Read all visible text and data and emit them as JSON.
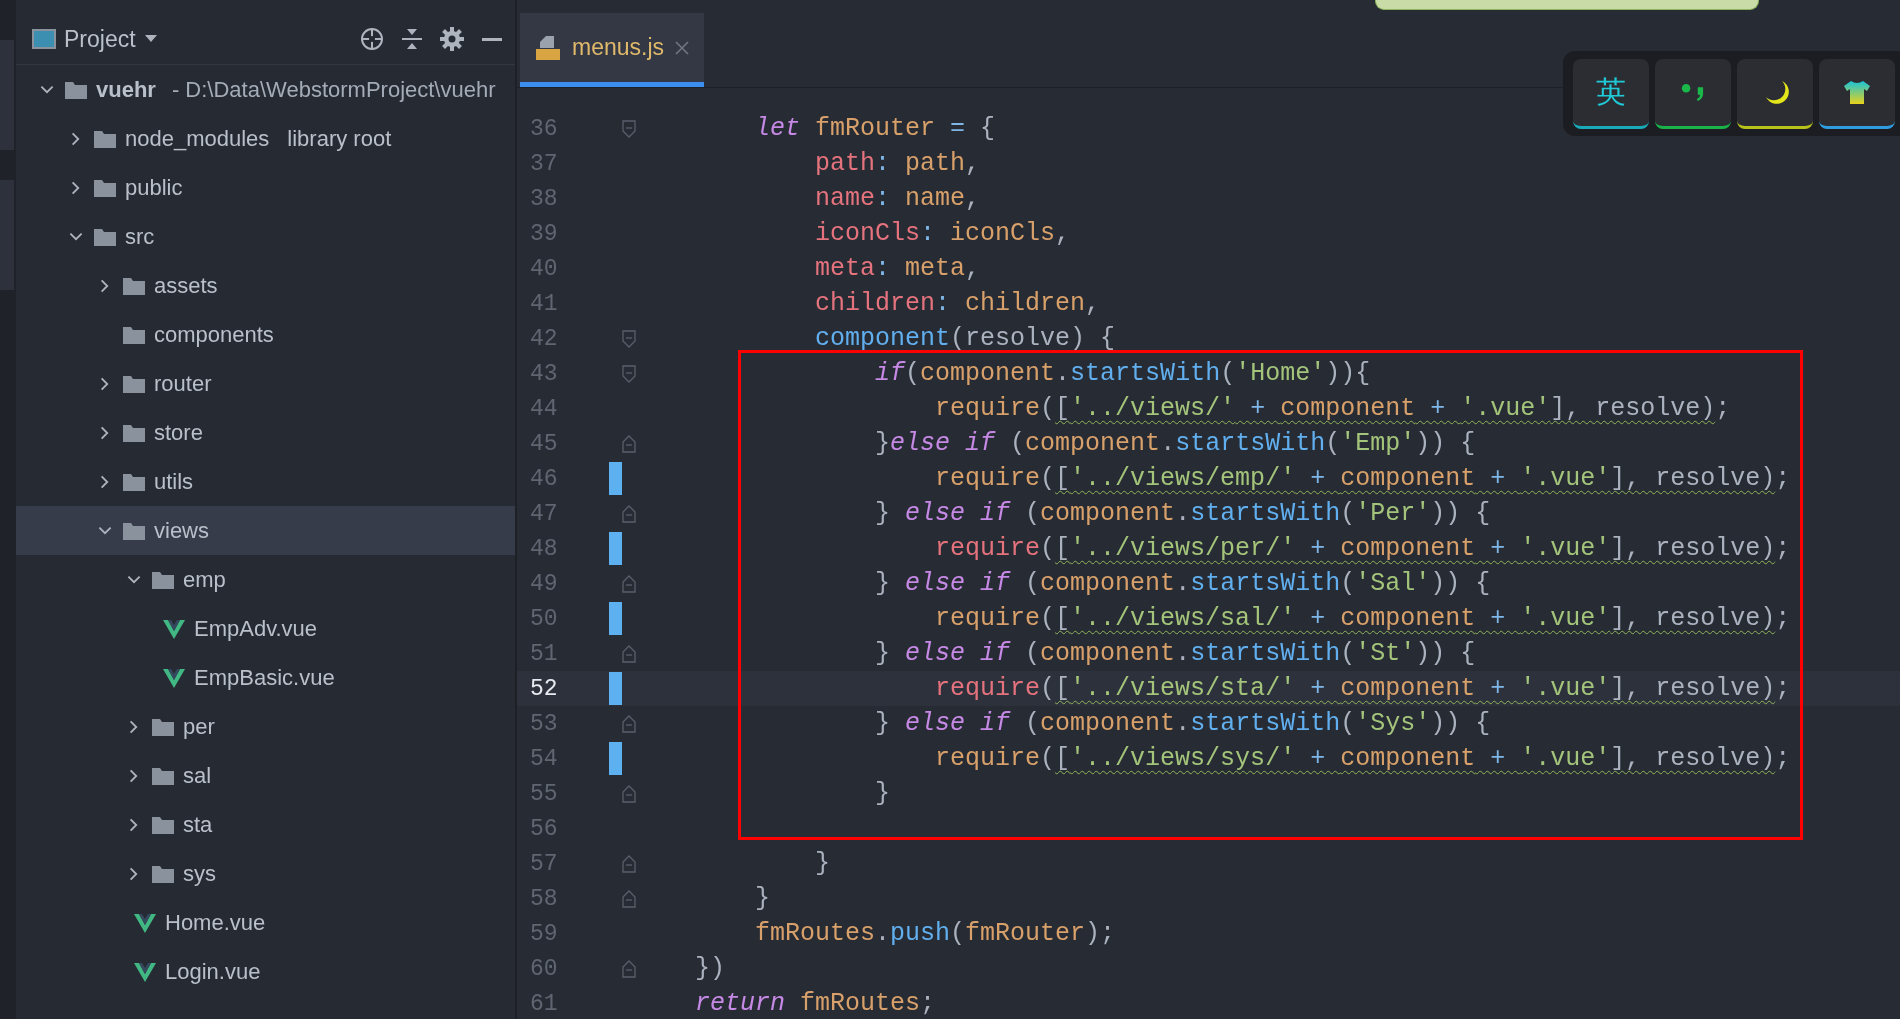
{
  "project_panel": {
    "title": "Project",
    "tree": [
      {
        "kind": "root",
        "label": "vuehr",
        "path": "- D:\\Data\\WebstormProject\\vuehr",
        "expanded": true,
        "selected": false,
        "children": [
          {
            "kind": "folder",
            "label": "node_modules",
            "suffix": "library root",
            "expanded": false,
            "selected": false
          },
          {
            "kind": "folder",
            "label": "public",
            "expanded": false,
            "selected": false
          },
          {
            "kind": "folder",
            "label": "src",
            "expanded": true,
            "selected": false,
            "children": [
              {
                "kind": "folder",
                "label": "assets",
                "expanded": false,
                "selected": false
              },
              {
                "kind": "empty_folder",
                "label": "components",
                "selected": false
              },
              {
                "kind": "folder",
                "label": "router",
                "expanded": false,
                "selected": false
              },
              {
                "kind": "folder",
                "label": "store",
                "expanded": false,
                "selected": false
              },
              {
                "kind": "folder",
                "label": "utils",
                "expanded": false,
                "selected": false
              },
              {
                "kind": "folder",
                "label": "views",
                "expanded": true,
                "selected": true,
                "children": [
                  {
                    "kind": "folder",
                    "label": "emp",
                    "expanded": true,
                    "selected": false,
                    "children": [
                      {
                        "kind": "vue",
                        "label": "EmpAdv.vue",
                        "selected": false
                      },
                      {
                        "kind": "vue",
                        "label": "EmpBasic.vue",
                        "selected": false
                      }
                    ]
                  },
                  {
                    "kind": "folder",
                    "label": "per",
                    "expanded": false,
                    "selected": false
                  },
                  {
                    "kind": "folder",
                    "label": "sal",
                    "expanded": false,
                    "selected": false
                  },
                  {
                    "kind": "folder",
                    "label": "sta",
                    "expanded": false,
                    "selected": false
                  },
                  {
                    "kind": "folder",
                    "label": "sys",
                    "expanded": false,
                    "selected": false
                  },
                  {
                    "kind": "vue",
                    "label": "Home.vue",
                    "selected": false
                  },
                  {
                    "kind": "vue",
                    "label": "Login.vue",
                    "selected": false
                  }
                ]
              }
            ]
          }
        ]
      }
    ]
  },
  "editor": {
    "tabs": [
      {
        "label": "menus.js",
        "selected": true
      }
    ],
    "lines": [
      {
        "number": "36",
        "kind": "block_start",
        "changed": false,
        "current": false,
        "tokens": [
          {
            "kind": "kw",
            "text": "    let"
          },
          {
            "kind": "var",
            "text": " fmRouter"
          },
          {
            "kind": "op",
            "text": " = "
          },
          {
            "kind": "punc",
            "text": "{"
          }
        ]
      },
      {
        "number": "37",
        "kind": "plain",
        "changed": false,
        "current": false,
        "tokens": [
          {
            "kind": "prop",
            "text": "        path"
          },
          {
            "kind": "op",
            "text": ": "
          },
          {
            "kind": "var",
            "text": "path"
          },
          {
            "kind": "punc",
            "text": ","
          }
        ]
      },
      {
        "number": "38",
        "kind": "plain",
        "changed": false,
        "current": false,
        "tokens": [
          {
            "kind": "prop",
            "text": "        name"
          },
          {
            "kind": "op",
            "text": ": "
          },
          {
            "kind": "var",
            "text": "name"
          },
          {
            "kind": "punc",
            "text": ","
          }
        ]
      },
      {
        "number": "39",
        "kind": "plain",
        "changed": false,
        "current": false,
        "tokens": [
          {
            "kind": "prop",
            "text": "        iconCls"
          },
          {
            "kind": "op",
            "text": ": "
          },
          {
            "kind": "var",
            "text": "iconCls"
          },
          {
            "kind": "punc",
            "text": ","
          }
        ]
      },
      {
        "number": "40",
        "kind": "plain",
        "changed": false,
        "current": false,
        "tokens": [
          {
            "kind": "prop",
            "text": "        meta"
          },
          {
            "kind": "op",
            "text": ": "
          },
          {
            "kind": "var",
            "text": "meta"
          },
          {
            "kind": "punc",
            "text": ","
          }
        ]
      },
      {
        "number": "41",
        "kind": "plain",
        "changed": false,
        "current": false,
        "tokens": [
          {
            "kind": "prop",
            "text": "        children"
          },
          {
            "kind": "op",
            "text": ": "
          },
          {
            "kind": "var",
            "text": "children"
          },
          {
            "kind": "punc",
            "text": ","
          }
        ]
      },
      {
        "number": "42",
        "kind": "block_start",
        "changed": false,
        "current": false,
        "tokens": [
          {
            "kind": "fn",
            "text": "        component"
          },
          {
            "kind": "punc",
            "text": "(resolve) {"
          }
        ]
      },
      {
        "number": "43",
        "kind": "block_start",
        "changed": false,
        "current": false,
        "tokens": [
          {
            "kind": "kw",
            "text": "            if"
          },
          {
            "kind": "punc",
            "text": "("
          },
          {
            "kind": "var",
            "text": "component"
          },
          {
            "kind": "punc",
            "text": "."
          },
          {
            "kind": "fn",
            "text": "startsWith"
          },
          {
            "kind": "punc",
            "text": "("
          },
          {
            "kind": "str",
            "text": "'Home'"
          },
          {
            "kind": "punc",
            "text": ")){"
          }
        ]
      },
      {
        "number": "44",
        "kind": "plain",
        "changed": false,
        "current": false,
        "tokens": [
          {
            "kind": "var",
            "text": "                require"
          },
          {
            "kind": "punc",
            "text": "("
          },
          {
            "kind": "punc",
            "text": "[",
            "squiggle": true
          },
          {
            "kind": "str",
            "text": "'../views/'",
            "squiggle": true
          },
          {
            "kind": "op",
            "text": " + ",
            "squiggle": true
          },
          {
            "kind": "var",
            "text": "component",
            "squiggle": true
          },
          {
            "kind": "op",
            "text": " + ",
            "squiggle": true
          },
          {
            "kind": "str",
            "text": "'.vue'",
            "squiggle": true
          },
          {
            "kind": "punc",
            "text": "], resolve)",
            "squiggle": true
          },
          {
            "kind": "punc",
            "text": ";"
          }
        ]
      },
      {
        "number": "45",
        "kind": "block_end",
        "changed": false,
        "current": false,
        "tokens": [
          {
            "kind": "punc",
            "text": "            }"
          },
          {
            "kind": "kw",
            "text": "else if"
          },
          {
            "kind": "punc",
            "text": " ("
          },
          {
            "kind": "var",
            "text": "component"
          },
          {
            "kind": "punc",
            "text": "."
          },
          {
            "kind": "fn",
            "text": "startsWith"
          },
          {
            "kind": "punc",
            "text": "("
          },
          {
            "kind": "str",
            "text": "'Emp'"
          },
          {
            "kind": "punc",
            "text": ")) {"
          }
        ]
      },
      {
        "number": "46",
        "kind": "plain",
        "changed": true,
        "current": false,
        "tokens": [
          {
            "kind": "var",
            "text": "                require"
          },
          {
            "kind": "punc",
            "text": "("
          },
          {
            "kind": "punc",
            "text": "[",
            "squiggle": true
          },
          {
            "kind": "str",
            "text": "'../views/emp/'",
            "squiggle": true
          },
          {
            "kind": "op",
            "text": " + ",
            "squiggle": true
          },
          {
            "kind": "var",
            "text": "component",
            "squiggle": true
          },
          {
            "kind": "op",
            "text": " + ",
            "squiggle": true
          },
          {
            "kind": "str",
            "text": "'.vue'",
            "squiggle": true
          },
          {
            "kind": "punc",
            "text": "], resolve)",
            "squiggle": true
          },
          {
            "kind": "punc",
            "text": ";"
          }
        ]
      },
      {
        "number": "47",
        "kind": "block_end",
        "changed": false,
        "current": false,
        "tokens": [
          {
            "kind": "punc",
            "text": "            } "
          },
          {
            "kind": "kw",
            "text": "else if"
          },
          {
            "kind": "punc",
            "text": " ("
          },
          {
            "kind": "var",
            "text": "component"
          },
          {
            "kind": "punc",
            "text": "."
          },
          {
            "kind": "fn",
            "text": "startsWith"
          },
          {
            "kind": "punc",
            "text": "("
          },
          {
            "kind": "str",
            "text": "'Per'"
          },
          {
            "kind": "punc",
            "text": ")) {"
          }
        ]
      },
      {
        "number": "48",
        "kind": "plain",
        "changed": true,
        "current": false,
        "tokens": [
          {
            "kind": "prop",
            "text": "                require"
          },
          {
            "kind": "punc",
            "text": "("
          },
          {
            "kind": "punc",
            "text": "[",
            "squiggle": true
          },
          {
            "kind": "str",
            "text": "'../views/per/'",
            "squiggle": true
          },
          {
            "kind": "op",
            "text": " + ",
            "squiggle": true
          },
          {
            "kind": "var",
            "text": "component",
            "squiggle": true
          },
          {
            "kind": "op",
            "text": " + ",
            "squiggle": true
          },
          {
            "kind": "str",
            "text": "'.vue'",
            "squiggle": true
          },
          {
            "kind": "punc",
            "text": "], resolve)",
            "squiggle": true
          },
          {
            "kind": "punc",
            "text": ";"
          }
        ]
      },
      {
        "number": "49",
        "kind": "block_end",
        "changed": false,
        "current": false,
        "tokens": [
          {
            "kind": "punc",
            "text": "            } "
          },
          {
            "kind": "kw",
            "text": "else if"
          },
          {
            "kind": "punc",
            "text": " ("
          },
          {
            "kind": "var",
            "text": "component"
          },
          {
            "kind": "punc",
            "text": "."
          },
          {
            "kind": "fn",
            "text": "startsWith"
          },
          {
            "kind": "punc",
            "text": "("
          },
          {
            "kind": "str",
            "text": "'Sal'"
          },
          {
            "kind": "punc",
            "text": ")) {"
          }
        ]
      },
      {
        "number": "50",
        "kind": "plain",
        "changed": true,
        "current": false,
        "tokens": [
          {
            "kind": "var",
            "text": "                require"
          },
          {
            "kind": "punc",
            "text": "("
          },
          {
            "kind": "punc",
            "text": "[",
            "squiggle": true
          },
          {
            "kind": "str",
            "text": "'../views/sal/'",
            "squiggle": true
          },
          {
            "kind": "op",
            "text": " + ",
            "squiggle": true
          },
          {
            "kind": "var",
            "text": "component",
            "squiggle": true
          },
          {
            "kind": "op",
            "text": " + ",
            "squiggle": true
          },
          {
            "kind": "str",
            "text": "'.vue'",
            "squiggle": true
          },
          {
            "kind": "punc",
            "text": "], resolve)",
            "squiggle": true
          },
          {
            "kind": "punc",
            "text": ";"
          }
        ]
      },
      {
        "number": "51",
        "kind": "block_end",
        "changed": false,
        "current": false,
        "tokens": [
          {
            "kind": "punc",
            "text": "            } "
          },
          {
            "kind": "kw",
            "text": "else if"
          },
          {
            "kind": "punc",
            "text": " ("
          },
          {
            "kind": "var",
            "text": "component"
          },
          {
            "kind": "punc",
            "text": "."
          },
          {
            "kind": "fn",
            "text": "startsWith"
          },
          {
            "kind": "punc",
            "text": "("
          },
          {
            "kind": "str",
            "text": "'St'"
          },
          {
            "kind": "punc",
            "text": ")) {"
          }
        ]
      },
      {
        "number": "52",
        "kind": "plain",
        "changed": true,
        "current": true,
        "tokens": [
          {
            "kind": "prop",
            "text": "                require"
          },
          {
            "kind": "punc",
            "text": "("
          },
          {
            "kind": "punc",
            "text": "[",
            "squiggle": true
          },
          {
            "kind": "str",
            "text": "'../views/sta/'",
            "squiggle": true
          },
          {
            "kind": "op",
            "text": " + ",
            "squiggle": true
          },
          {
            "kind": "var",
            "text": "component",
            "squiggle": true
          },
          {
            "kind": "op",
            "text": " + ",
            "squiggle": true
          },
          {
            "kind": "str",
            "text": "'.vue'",
            "squiggle": true
          },
          {
            "kind": "punc",
            "text": "], resolve)",
            "squiggle": true
          },
          {
            "kind": "punc",
            "text": ";"
          }
        ]
      },
      {
        "number": "53",
        "kind": "block_end",
        "changed": false,
        "current": false,
        "tokens": [
          {
            "kind": "punc",
            "text": "            } "
          },
          {
            "kind": "kw",
            "text": "else if"
          },
          {
            "kind": "punc",
            "text": " ("
          },
          {
            "kind": "var",
            "text": "component"
          },
          {
            "kind": "punc",
            "text": "."
          },
          {
            "kind": "fn",
            "text": "startsWith"
          },
          {
            "kind": "punc",
            "text": "("
          },
          {
            "kind": "str",
            "text": "'Sys'"
          },
          {
            "kind": "punc",
            "text": ")) {"
          }
        ]
      },
      {
        "number": "54",
        "kind": "plain",
        "changed": true,
        "current": false,
        "tokens": [
          {
            "kind": "var",
            "text": "                require"
          },
          {
            "kind": "punc",
            "text": "("
          },
          {
            "kind": "punc",
            "text": "[",
            "squiggle": true
          },
          {
            "kind": "str",
            "text": "'../views/sys/'",
            "squiggle": true
          },
          {
            "kind": "op",
            "text": " + ",
            "squiggle": true
          },
          {
            "kind": "var",
            "text": "component",
            "squiggle": true
          },
          {
            "kind": "op",
            "text": " + ",
            "squiggle": true
          },
          {
            "kind": "str",
            "text": "'.vue'",
            "squiggle": true
          },
          {
            "kind": "punc",
            "text": "], resolve)",
            "squiggle": true
          },
          {
            "kind": "punc",
            "text": ";"
          }
        ]
      },
      {
        "number": "55",
        "kind": "block_end",
        "changed": false,
        "current": false,
        "tokens": [
          {
            "kind": "punc",
            "text": "            }"
          }
        ]
      },
      {
        "number": "56",
        "kind": "plain",
        "changed": false,
        "current": false
      },
      {
        "number": "57",
        "kind": "block_end",
        "changed": false,
        "current": false,
        "tokens": [
          {
            "kind": "punc",
            "text": "        }"
          }
        ]
      },
      {
        "number": "58",
        "kind": "block_end",
        "changed": false,
        "current": false,
        "tokens": [
          {
            "kind": "punc",
            "text": "    }"
          }
        ]
      },
      {
        "number": "59",
        "kind": "plain",
        "changed": false,
        "current": false,
        "tokens": [
          {
            "kind": "var",
            "text": "    fmRoutes"
          },
          {
            "kind": "punc",
            "text": "."
          },
          {
            "kind": "fn",
            "text": "push"
          },
          {
            "kind": "punc",
            "text": "("
          },
          {
            "kind": "var",
            "text": "fmRouter"
          },
          {
            "kind": "punc",
            "text": ");"
          }
        ]
      },
      {
        "number": "60",
        "kind": "block_end",
        "changed": false,
        "current": false,
        "tokens": [
          {
            "kind": "punc",
            "text": "})"
          }
        ]
      },
      {
        "number": "61",
        "kind": "plain",
        "changed": false,
        "current": false,
        "tokens": [
          {
            "kind": "kw",
            "text": "return"
          },
          {
            "kind": "var",
            "text": " fmRoutes"
          },
          {
            "kind": "punc",
            "text": ";"
          }
        ]
      }
    ]
  },
  "ime_toolbar": {
    "buttons": [
      {
        "kind": "text",
        "label": "英"
      },
      {
        "kind": "punctuation"
      },
      {
        "kind": "moon"
      },
      {
        "kind": "shirt"
      }
    ]
  }
}
